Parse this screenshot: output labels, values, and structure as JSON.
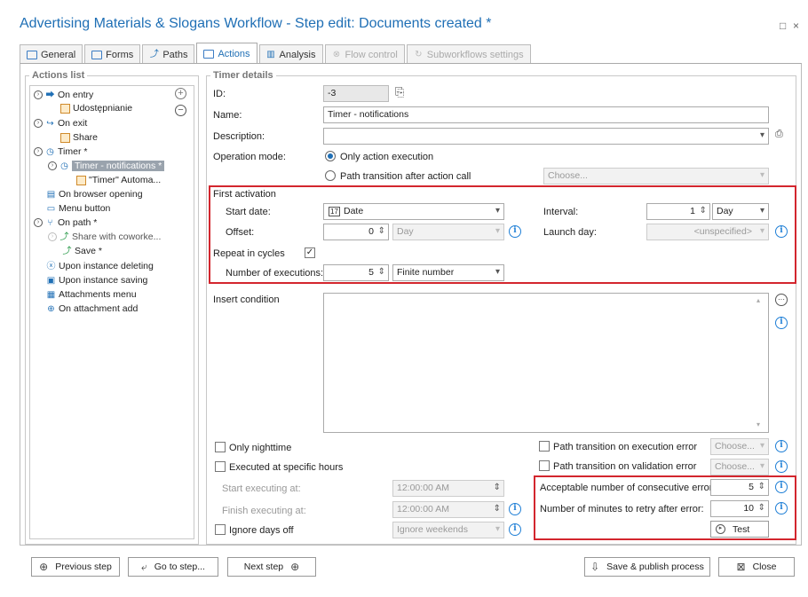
{
  "window": {
    "title": "Advertising Materials & Slogans Workflow - Step edit: Documents created *",
    "maximize": "□",
    "close": "×"
  },
  "tabs": [
    {
      "label": "General"
    },
    {
      "label": "Forms"
    },
    {
      "label": "Paths"
    },
    {
      "label": "Actions"
    },
    {
      "label": "Analysis"
    },
    {
      "label": "Flow control"
    },
    {
      "label": "Subworkflows settings"
    }
  ],
  "actions_list": {
    "legend": "Actions list",
    "items": [
      {
        "label": "On entry"
      },
      {
        "label": "Udostępnianie"
      },
      {
        "label": "On exit"
      },
      {
        "label": "Share"
      },
      {
        "label": "Timer *"
      },
      {
        "label": "Timer - notifications *"
      },
      {
        "label": "\"Timer\" Automa..."
      },
      {
        "label": "On browser opening"
      },
      {
        "label": "Menu button"
      },
      {
        "label": "On path *"
      },
      {
        "label": "Share with coworke..."
      },
      {
        "label": "Save *"
      },
      {
        "label": "Upon instance deleting"
      },
      {
        "label": "Upon instance saving"
      },
      {
        "label": "Attachments menu"
      },
      {
        "label": "On attachment add"
      }
    ]
  },
  "timer": {
    "legend": "Timer details",
    "id_label": "ID:",
    "id_value": "-3",
    "name_label": "Name:",
    "name_value": "Timer - notifications",
    "desc_label": "Description:",
    "desc_value": "",
    "mode_label": "Operation mode:",
    "mode_opt1": "Only action execution",
    "mode_opt2": "Path transition after action call",
    "choose": "Choose...",
    "first_activation": "First activation",
    "start_date_label": "Start date:",
    "start_date_value": "Date",
    "offset_label": "Offset:",
    "offset_value": "0",
    "offset_unit": "Day",
    "interval_label": "Interval:",
    "interval_value": "1",
    "interval_unit": "Day",
    "launch_day_label": "Launch day:",
    "launch_day_value": "<unspecified>",
    "repeat_label": "Repeat in cycles",
    "repeat_checked": "✓",
    "num_exec_label": "Number of executions:",
    "num_exec_value": "5",
    "num_exec_mode": "Finite number",
    "insert_condition": "Insert condition",
    "only_nighttime": "Only nighttime",
    "exec_specific_hours": "Executed at specific hours",
    "start_exec_label": "Start executing at:",
    "start_exec_value": "12:00:00 AM",
    "finish_exec_label": "Finish executing at:",
    "finish_exec_value": "12:00:00 AM",
    "ignore_days_off": "Ignore days off",
    "ignore_weekends": "Ignore weekends",
    "path_exec_error": "Path transition on execution error",
    "path_valid_error": "Path transition on validation error",
    "acceptable_errors_label": "Acceptable number of consecutive errors:",
    "acceptable_errors_value": "5",
    "retry_minutes_label": "Number of minutes to retry after error:",
    "retry_minutes_value": "10",
    "test": "Test"
  },
  "footer": {
    "previous": "Previous step",
    "goto": "Go to step...",
    "next": "Next step",
    "save_publish": "Save & publish process",
    "close": "Close"
  },
  "colors": {
    "accent": "#1f6fb5",
    "highlight": "#d3262e",
    "selected": "#9aa3ad"
  }
}
